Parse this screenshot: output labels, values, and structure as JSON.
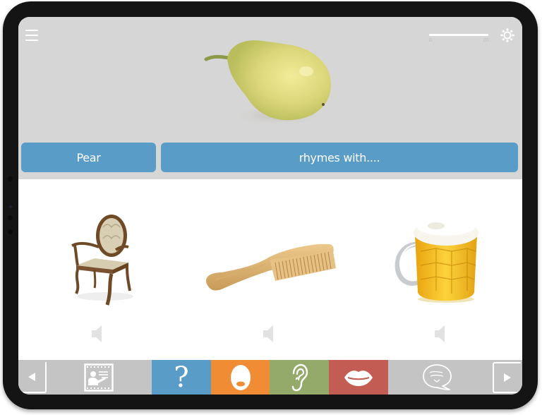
{
  "app": {
    "header": {
      "menu_icon": "hamburger-menu-icon",
      "settings_icon": "gear-icon",
      "progress": {
        "min_label": "0",
        "max_label": "20",
        "current": 0,
        "max": 20
      }
    },
    "prompt": {
      "image": "pear",
      "word_label": "Pear",
      "instruction_label": "rhymes with...."
    },
    "choices": [
      {
        "image": "chair",
        "audio_icon": "speaker-icon"
      },
      {
        "image": "comb",
        "audio_icon": "speaker-icon"
      },
      {
        "image": "beer-mug",
        "audio_icon": "speaker-icon"
      }
    ],
    "toolbar": {
      "items": [
        {
          "name": "previous",
          "icon": "triangle-left-icon"
        },
        {
          "name": "lesson",
          "icon": "teacher-presentation-icon"
        },
        {
          "name": "question",
          "icon": "question-mark-icon",
          "color": "#5a9cc8"
        },
        {
          "name": "open-mouth",
          "icon": "open-mouth-icon",
          "color": "#ef8c34"
        },
        {
          "name": "listen",
          "icon": "ear-icon",
          "color": "#94aa6a"
        },
        {
          "name": "lips",
          "icon": "lips-icon",
          "color": "#c35c52"
        },
        {
          "name": "speech",
          "icon": "speech-bubble-icon"
        },
        {
          "name": "next",
          "icon": "triangle-right-icon"
        }
      ],
      "question_glyph": "?"
    },
    "colors": {
      "accent_blue": "#5a9cc8",
      "top_background": "#d6d6d6",
      "toolbar_gray": "#c4c4c4"
    }
  }
}
